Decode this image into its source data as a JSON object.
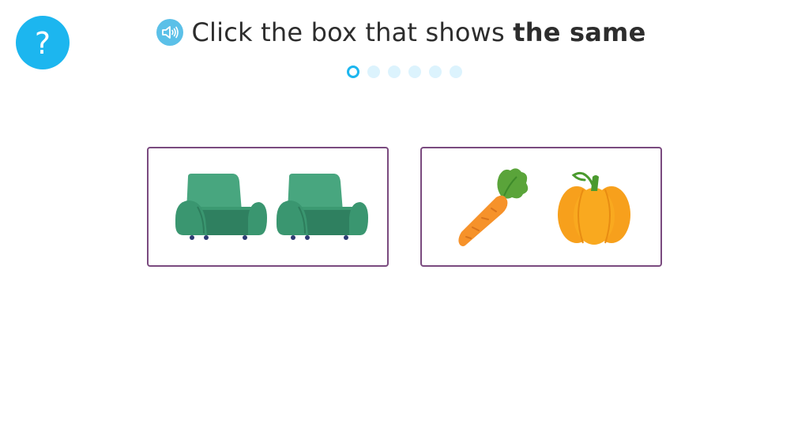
{
  "help": {
    "label": "?"
  },
  "question": {
    "text_plain": "Click the box that shows ",
    "text_bold": "the same"
  },
  "progress": {
    "current": 1,
    "total": 6
  },
  "choices": [
    {
      "items": [
        "armchair",
        "armchair"
      ]
    },
    {
      "items": [
        "carrot",
        "pumpkin"
      ]
    }
  ],
  "colors": {
    "accent": "#1cb6ef",
    "box_border": "#7a4a7f",
    "armchair": "#43a47c",
    "carrot": "#f6922a",
    "pumpkin": "#f7a01c"
  },
  "icons": {
    "help": "question-mark-icon",
    "audio": "speaker-icon"
  }
}
